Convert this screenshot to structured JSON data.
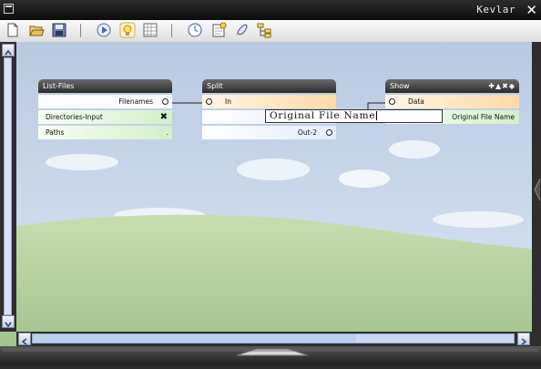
{
  "window": {
    "title": "Kevlar",
    "close_glyph": "✕"
  },
  "toolbar": {
    "buttons": [
      {
        "name": "new-icon"
      },
      {
        "name": "open-folder-icon"
      },
      {
        "name": "save-icon"
      },
      {
        "name": "play-icon"
      },
      {
        "name": "lightbulb-icon"
      },
      {
        "name": "grid-icon"
      },
      {
        "name": "clock-icon"
      },
      {
        "name": "note-icon"
      },
      {
        "name": "rocket-icon"
      },
      {
        "name": "tree-icon"
      }
    ]
  },
  "nodes": {
    "list_files": {
      "title": "List-Files",
      "rows": [
        {
          "label": "Filenames"
        },
        {
          "label": "Directories-Input",
          "action_glyph": "✖"
        },
        {
          "label": "Paths",
          "dot": "."
        }
      ]
    },
    "split": {
      "title": "Split",
      "rows": [
        {
          "label": "In"
        },
        {
          "label": ""
        },
        {
          "label": "Out-2"
        }
      ]
    },
    "show": {
      "title": "Show",
      "header_icons": "✚▲✖◆",
      "rows": [
        {
          "label": "Data"
        },
        {
          "label": "Original File Name"
        }
      ]
    }
  },
  "tooltip": {
    "text": "Original File Name"
  },
  "colors": {
    "header_dark": "#2c2c2c",
    "accent_scroll": "#c9d8ef",
    "row_orange": "#ffd9a8",
    "row_green": "#d3efca"
  }
}
